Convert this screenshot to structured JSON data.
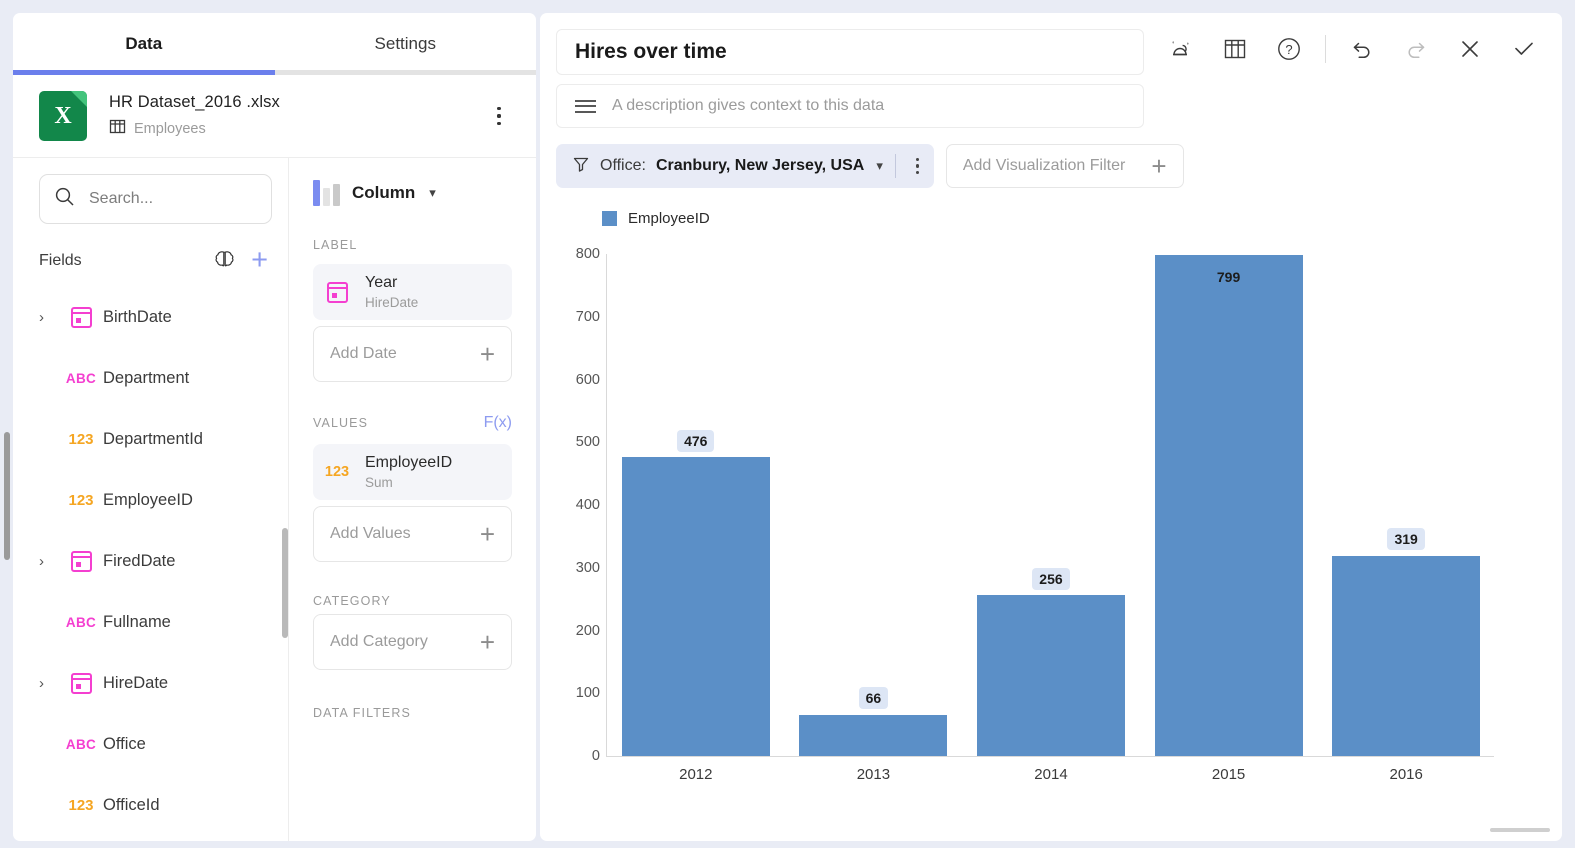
{
  "left_panel": {
    "tabs": [
      {
        "label": "Data",
        "active": true
      },
      {
        "label": "Settings",
        "active": false
      }
    ],
    "file": {
      "name": "HR Dataset_2016 .xlsx",
      "sheet": "Employees",
      "icon": "excel-file-icon",
      "icon_letter": "X"
    },
    "search": {
      "placeholder": "Search...",
      "value": ""
    },
    "fields_header": {
      "title": "Fields",
      "ai_icon": "brain-icon",
      "add_icon": "plus-icon"
    },
    "fields": [
      {
        "name": "BirthDate",
        "type": "date",
        "expandable": true
      },
      {
        "name": "Department",
        "type": "abc",
        "expandable": false
      },
      {
        "name": "DepartmentId",
        "type": "123",
        "expandable": false
      },
      {
        "name": "EmployeeID",
        "type": "123",
        "expandable": false
      },
      {
        "name": "FiredDate",
        "type": "date",
        "expandable": true
      },
      {
        "name": "Fullname",
        "type": "abc",
        "expandable": false
      },
      {
        "name": "HireDate",
        "type": "date",
        "expandable": true
      },
      {
        "name": "Office",
        "type": "abc",
        "expandable": false
      },
      {
        "name": "OfficeId",
        "type": "123",
        "expandable": false
      }
    ],
    "type_labels": {
      "abc": "ABC",
      "num": "123"
    }
  },
  "config_panel": {
    "chart_type": "Column",
    "sections": {
      "label": {
        "heading": "LABEL",
        "chip": {
          "title": "Year",
          "subtitle": "HireDate",
          "icon": "calendar-icon"
        },
        "add": {
          "label": "Add Date"
        }
      },
      "values": {
        "heading": "VALUES",
        "formula_label": "F(x)",
        "chip": {
          "title": "EmployeeID",
          "subtitle": "Sum",
          "icon": "123"
        },
        "add": {
          "label": "Add Values"
        }
      },
      "category": {
        "heading": "CATEGORY",
        "add": {
          "label": "Add Category"
        }
      },
      "data_filters": {
        "heading": "DATA FILTERS"
      }
    }
  },
  "right_panel": {
    "title": {
      "value": "Hires over time"
    },
    "description": {
      "placeholder": "A description gives context to this data",
      "value": ""
    },
    "toolbar": [
      {
        "name": "ai-insight-icon",
        "label": "AI Insight"
      },
      {
        "name": "table-icon",
        "label": "Table view"
      },
      {
        "name": "help-icon",
        "label": "Help"
      },
      {
        "name": "undo-icon",
        "label": "Undo"
      },
      {
        "name": "redo-icon",
        "label": "Redo"
      },
      {
        "name": "close-icon",
        "label": "Close"
      },
      {
        "name": "check-icon",
        "label": "Apply"
      }
    ],
    "filters": {
      "active": {
        "field": "Office:",
        "value": "Cranbury, New Jersey, USA"
      },
      "add": {
        "label": "Add Visualization Filter"
      }
    }
  },
  "chart_data": {
    "type": "bar",
    "title": "Hires over time",
    "categories": [
      "2012",
      "2013",
      "2014",
      "2015",
      "2016"
    ],
    "values": [
      476,
      66,
      256,
      799,
      319
    ],
    "series": [
      {
        "name": "EmployeeID",
        "values": [
          476,
          66,
          256,
          799,
          319
        ]
      }
    ],
    "legend": [
      "EmployeeID"
    ],
    "legend_position": "top-left",
    "xlabel": "",
    "ylabel": "",
    "ylim": [
      0,
      800
    ],
    "yticks": [
      800,
      700,
      600,
      500,
      400,
      300,
      200,
      100,
      0
    ],
    "grid": false,
    "bar_color": "#5b8fc7",
    "data_label_bg": "#dde6f5"
  }
}
